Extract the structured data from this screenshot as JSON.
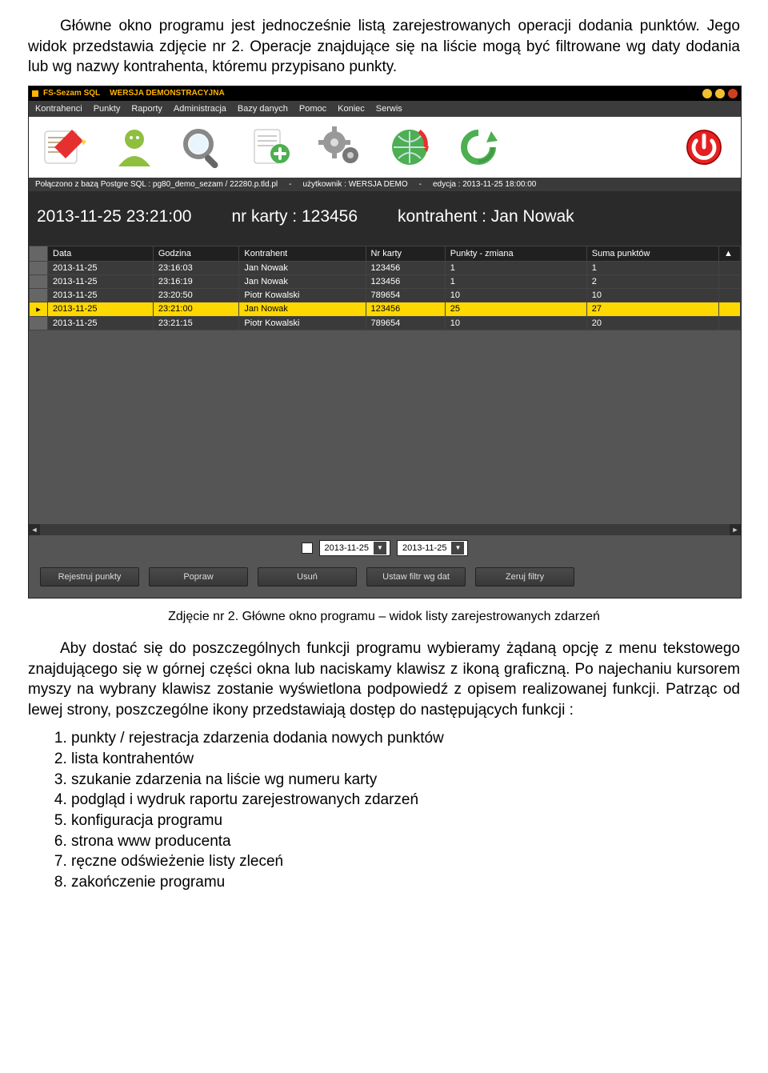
{
  "doc": {
    "para1": "Główne okno programu jest jednocześnie listą zarejestrowanych operacji dodania punktów. Jego widok przedstawia zdjęcie nr 2. Operacje znajdujące się na liście mogą być filtrowane wg daty dodania lub wg nazwy kontrahenta, któremu przypisano punkty.",
    "caption": "Zdjęcie nr 2. Główne okno programu – widok listy zarejestrowanych zdarzeń",
    "para2": "Aby dostać się do poszczególnych funkcji programu wybieramy żądaną opcję z menu tekstowego znajdującego się w górnej części okna lub naciskamy klawisz z ikoną graficzną. Po najechaniu kursorem myszy na wybrany klawisz zostanie wyświetlona podpowiedź z opisem realizowanej funkcji. Patrząc od lewej strony, poszczególne ikony przedstawiają dostęp do następujących funkcji :",
    "funcs": [
      "punkty / rejestracja zdarzenia dodania nowych punktów",
      "lista kontrahentów",
      "szukanie zdarzenia na liście wg numeru karty",
      "podgląd i wydruk raportu zarejestrowanych zdarzeń",
      "konfiguracja programu",
      "strona www producenta",
      "ręczne odświeżenie listy zleceń",
      "zakończenie programu"
    ]
  },
  "app": {
    "title_main": "FS-Sezam SQL",
    "title_demo": "WERSJA DEMONSTRACYJNA",
    "menu": [
      "Kontrahenci",
      "Punkty",
      "Raporty",
      "Administracja",
      "Bazy danych",
      "Pomoc",
      "Koniec",
      "Serwis"
    ],
    "status": {
      "conn": "Połączono z bazą Postgre SQL  : pg80_demo_sezam / 22280.p.tld.pl",
      "user": "użytkownik : WERSJA DEMO",
      "edit": "edycja : 2013-11-25  18:00:00"
    },
    "big": {
      "datetime": "2013-11-25 23:21:00",
      "card": "nr karty : 123456",
      "contr": "kontrahent : Jan Nowak"
    },
    "columns": [
      "Data",
      "Godzina",
      "Kontrahent",
      "Nr karty",
      "Punkty - zmiana",
      "Suma punktów"
    ],
    "rows": [
      {
        "d": "2013-11-25",
        "g": "23:16:03",
        "k": "Jan Nowak",
        "n": "123456",
        "p": "1",
        "s": "1",
        "sel": false
      },
      {
        "d": "2013-11-25",
        "g": "23:16:19",
        "k": "Jan Nowak",
        "n": "123456",
        "p": "1",
        "s": "2",
        "sel": false
      },
      {
        "d": "2013-11-25",
        "g": "23:20:50",
        "k": "Piotr Kowalski",
        "n": "789654",
        "p": "10",
        "s": "10",
        "sel": false
      },
      {
        "d": "2013-11-25",
        "g": "23:21:00",
        "k": "Jan Nowak",
        "n": "123456",
        "p": "25",
        "s": "27",
        "sel": true
      },
      {
        "d": "2013-11-25",
        "g": "23:21:15",
        "k": "Piotr Kowalski",
        "n": "789654",
        "p": "10",
        "s": "20",
        "sel": false
      }
    ],
    "filter": {
      "date1": "2013-11-25",
      "date2": "2013-11-25"
    },
    "buttons": [
      "Rejestruj punkty",
      "Popraw",
      "Usuń",
      "Ustaw filtr wg dat",
      "Zeruj filtry"
    ]
  }
}
